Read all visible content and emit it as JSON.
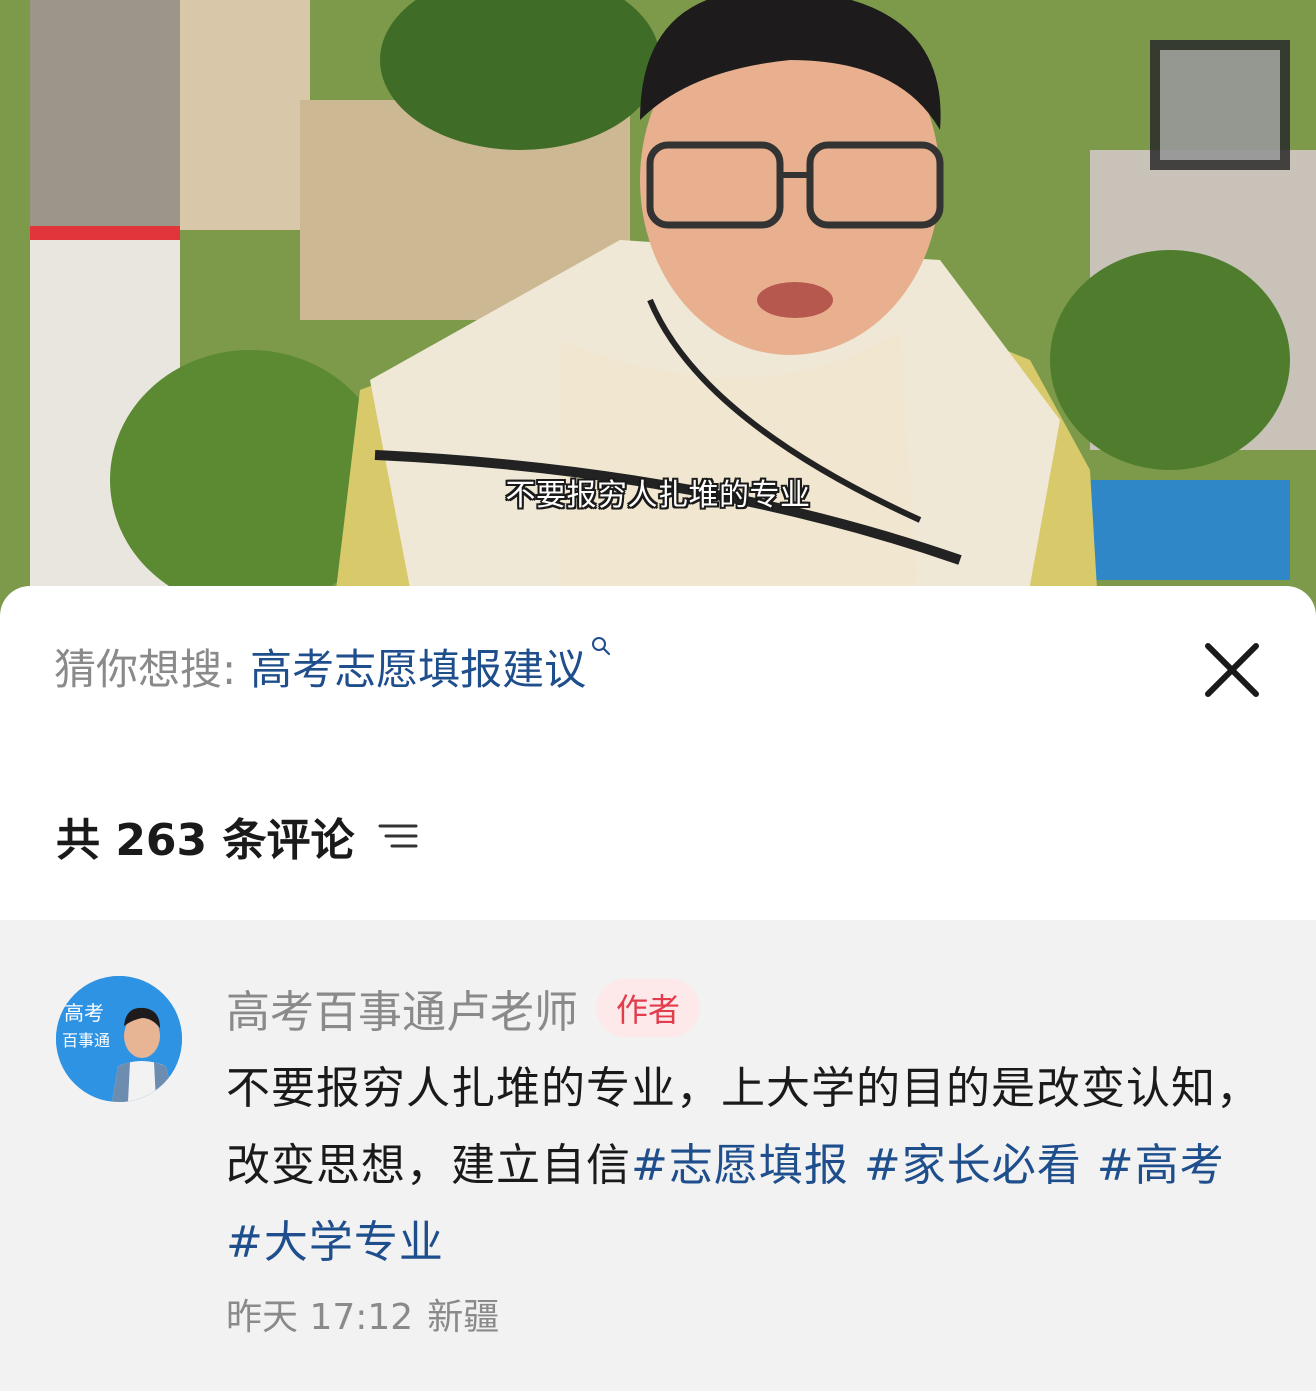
{
  "video": {
    "subtitle": "不要报穷人扎堆的专业"
  },
  "search_suggestion": {
    "prefix": "猜你想搜:",
    "query": "高考志愿填报建议"
  },
  "comments_header": {
    "title": "共 263 条评论"
  },
  "comment": {
    "author": "高考百事通卢老师",
    "badge": "作者",
    "avatar_text_line1": "高考",
    "avatar_text_line2": "百事通",
    "body_plain": "不要报穷人扎堆的专业，上大学的目的是改变认知，改变思想，建立自信",
    "hashtags": [
      "#志愿填报",
      "#家长必看",
      "#高考",
      "#大学专业"
    ],
    "time": "昨天 17:12",
    "location": "新疆"
  },
  "colors": {
    "link": "#1f4e8c",
    "badge_text": "#e23c4d",
    "badge_bg": "#fde9ea",
    "muted": "#8a8a8a",
    "comment_bg": "#f2f2f2"
  }
}
